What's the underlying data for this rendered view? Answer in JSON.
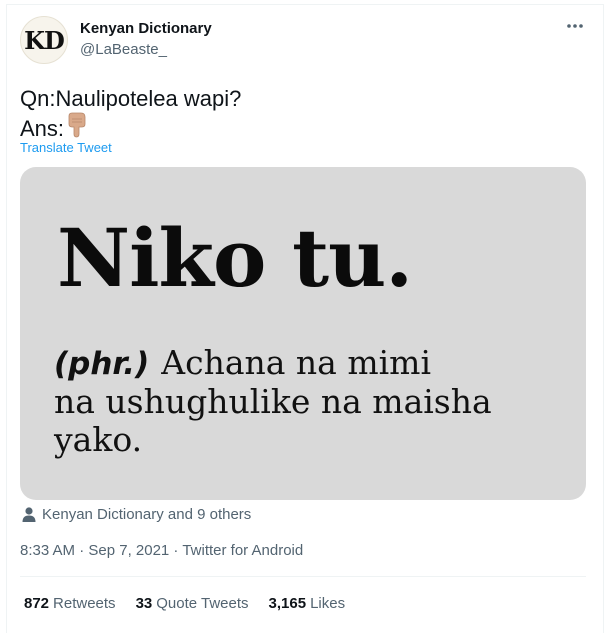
{
  "author": {
    "avatar_text": "KD",
    "name": "Kenyan Dictionary",
    "handle": "@LaBeaste_"
  },
  "more_icon": "more-horizontal-icon",
  "tweet": {
    "line1": "Qn:Naulipotelea wapi?",
    "line2": "Ans:",
    "emoji": "pointing-down-hand-icon",
    "translate_label": "Translate Tweet"
  },
  "media": {
    "headword": "Niko tu.",
    "part_of_speech": "(phr.)",
    "definition_line1": "Achana na mimi",
    "definition_line2": "na ushughulike na maisha",
    "definition_line3": "yako.",
    "background": "#d9d9d9"
  },
  "likers": {
    "icon": "person-icon",
    "text": "Kenyan Dictionary and 9 others"
  },
  "meta": {
    "time": "8:33 AM · Sep 7, 2021 · Twitter for Android"
  },
  "stats": {
    "retweets_count": "872",
    "retweets_label": "Retweets",
    "quotes_count": "33",
    "quotes_label": "Quote Tweets",
    "likes_count": "3,165",
    "likes_label": "Likes"
  },
  "colors": {
    "link": "#1d9bf0",
    "secondary_text": "#536471",
    "primary_text": "#0f1419"
  }
}
